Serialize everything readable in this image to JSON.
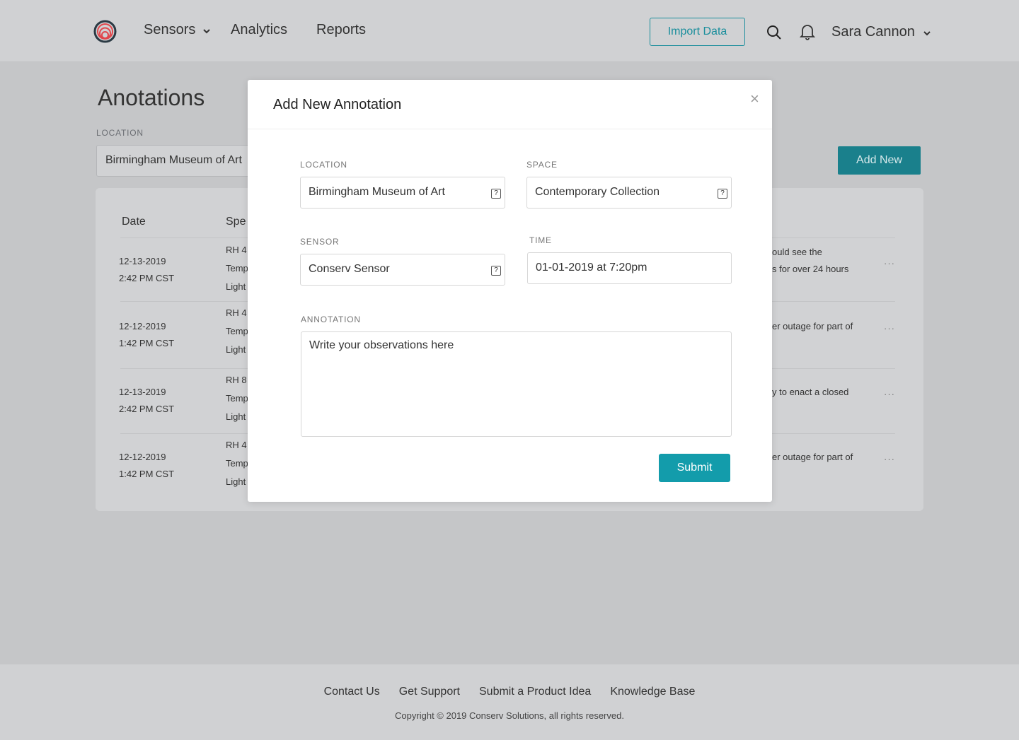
{
  "header": {
    "nav": [
      {
        "label": "Sensors",
        "has_dropdown": true
      },
      {
        "label": "Analytics"
      },
      {
        "label": "Reports"
      }
    ],
    "import_label": "Import Data",
    "user_name": "Sara Cannon",
    "icons": [
      "logo",
      "search-icon",
      "bell-icon",
      "chevron-down-icon"
    ]
  },
  "page": {
    "title": "Anotations",
    "location_label": "LOCATION",
    "location_value": "Birmingham Museum of Art",
    "add_new_label": "Add New"
  },
  "table": {
    "headers": [
      "Date",
      "Spe"
    ],
    "rows": [
      {
        "date": "12-13-2019",
        "time": "2:42 PM CST",
        "specs": [
          "RH 4",
          "Temp",
          "Light"
        ],
        "note": [
          "ould see the",
          "s for over 24 hours"
        ]
      },
      {
        "date": "12-12-2019",
        "time": "1:42 PM CST",
        "specs": [
          "RH 4",
          "Temp",
          "Light"
        ],
        "note": [
          "er outage for part of"
        ]
      },
      {
        "date": "12-13-2019",
        "time": "2:42 PM CST",
        "specs": [
          "RH 8",
          "Temp",
          "Light"
        ],
        "note": [
          "y to enact a closed"
        ]
      },
      {
        "date": "12-12-2019",
        "time": "1:42 PM CST",
        "specs": [
          "RH 4",
          "Temp",
          "Light"
        ],
        "note": [
          "er outage for part of"
        ]
      }
    ],
    "more_label": "···"
  },
  "modal": {
    "title": "Add New Annotation",
    "close_label": "×",
    "location_label": "LOCATION",
    "location_value": "Birmingham Museum of Art",
    "space_label": "SPACE",
    "space_value": "Contemporary Collection",
    "sensor_label": "SENSOR",
    "sensor_value": "Conserv Sensor",
    "time_label": "TIME",
    "time_value": "01-01-2019 at 7:20pm",
    "annotation_label": "ANNOTATION",
    "annotation_placeholder": "Write your observations here",
    "help_icon": "?",
    "submit_label": "Submit"
  },
  "footer": {
    "links": [
      "Contact Us",
      "Get Support",
      "Submit a Product Idea",
      "Knowledge Base"
    ],
    "copyright": "Copyright © 2019 Conserv Solutions, all rights reserved."
  },
  "colors": {
    "accent": "#139cab",
    "logo_ring": "#2b3a44",
    "logo_red": "#e0474c"
  }
}
